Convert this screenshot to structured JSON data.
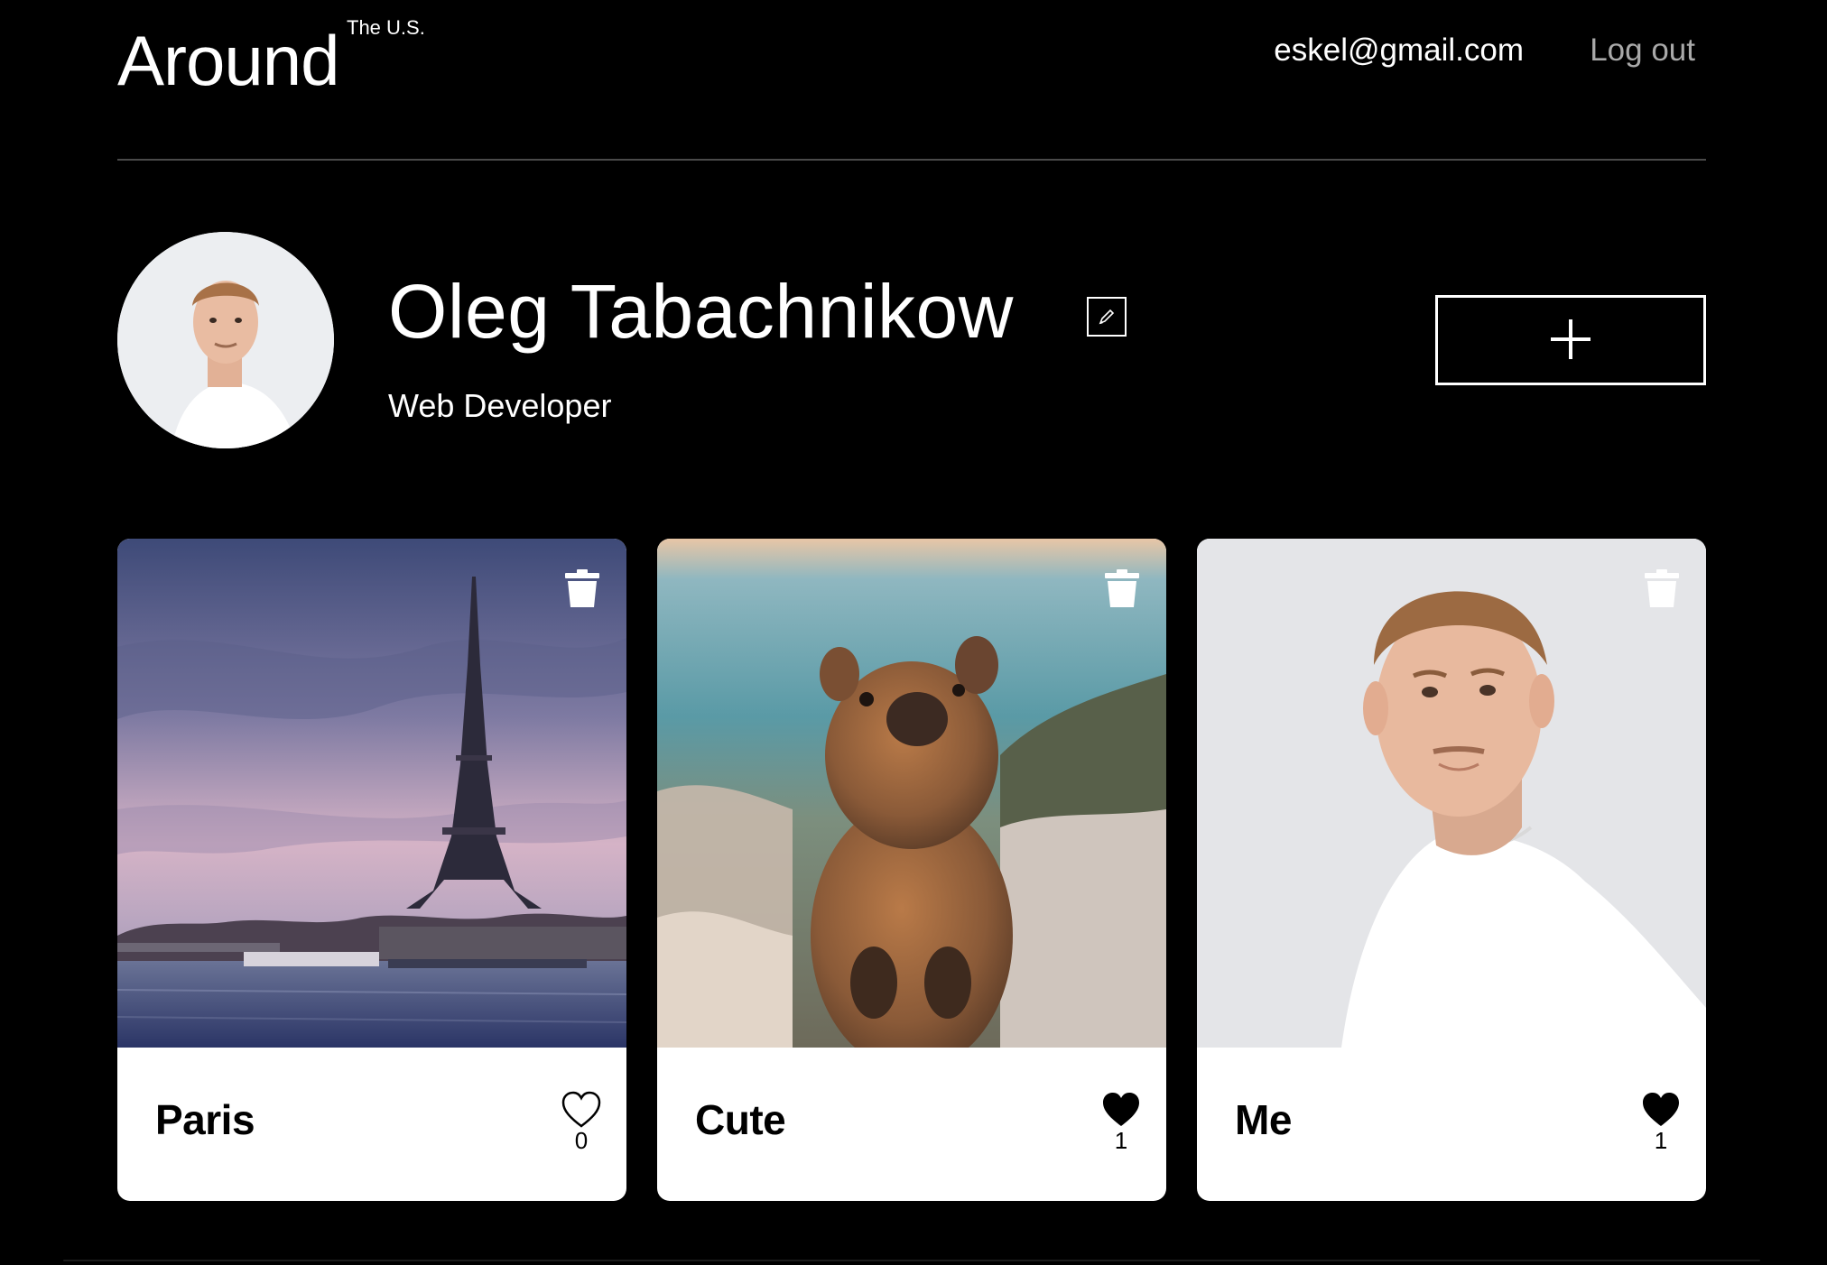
{
  "header": {
    "logo": "Around",
    "logo_sup": "The U.S.",
    "email": "eskel@gmail.com",
    "logout": "Log out"
  },
  "profile": {
    "name": "Oleg Tabachnikow",
    "about": "Web Developer"
  },
  "cards": [
    {
      "title": "Paris",
      "likes": "0",
      "liked": false
    },
    {
      "title": "Cute",
      "likes": "1",
      "liked": true
    },
    {
      "title": "Me",
      "likes": "1",
      "liked": true
    }
  ],
  "icons": {
    "edit": "pencil-icon",
    "add": "plus-icon",
    "delete": "trash-icon",
    "like": "heart-icon"
  },
  "colors": {
    "background": "#000000",
    "card": "#ffffff",
    "logout": "#a9a9a9",
    "divider": "#4a4a4a"
  }
}
